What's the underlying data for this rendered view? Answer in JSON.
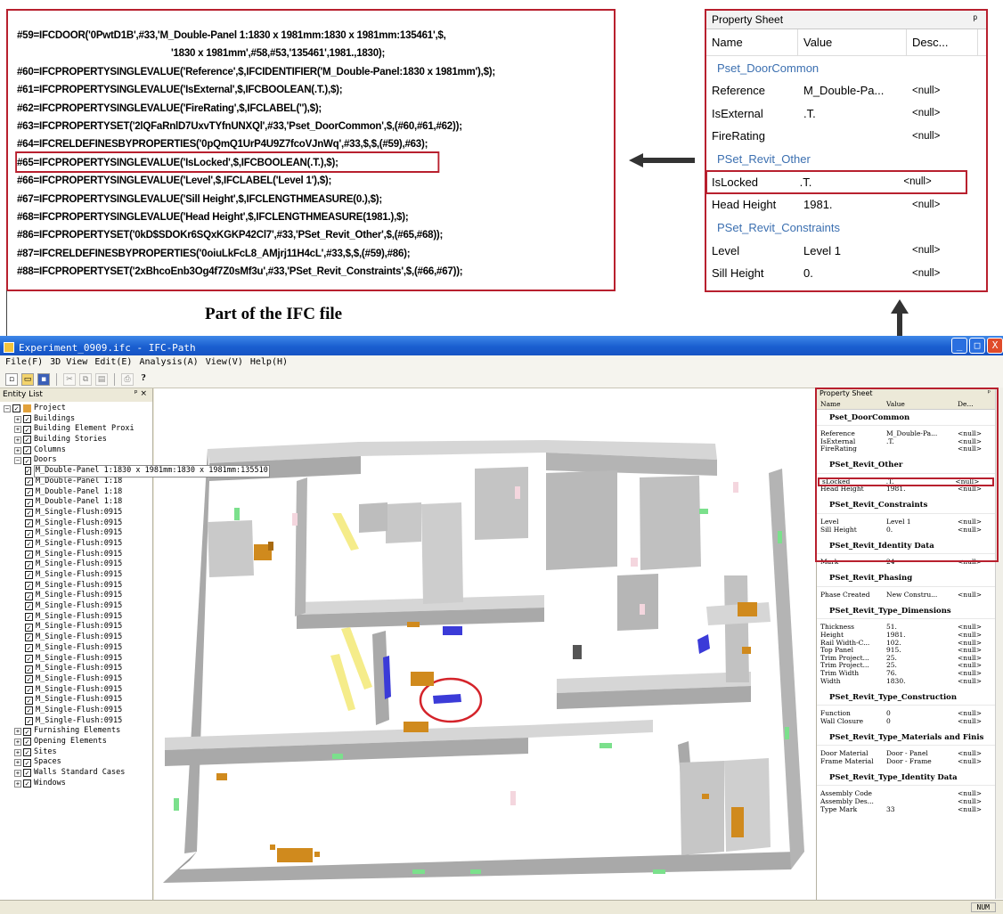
{
  "ifc_excerpt": {
    "lines": [
      "#59=IFCDOOR('0PwtD1B',#33,'M_Double-Panel 1:1830 x 1981mm:1830 x 1981mm:135461',$,",
      "'1830 x 1981mm',#58,#53,'135461',1981.,1830);",
      "#60=IFCPROPERTYSINGLEVALUE('Reference',$,IFCIDENTIFIER('M_Double-Panel:1830 x 1981mm'),$);",
      "#61=IFCPROPERTYSINGLEVALUE('IsExternal',$,IFCBOOLEAN(.T.),$);",
      "#62=IFCPROPERTYSINGLEVALUE('FireRating',$,IFCLABEL(''),$);",
      "#63=IFCPROPERTYSET('2lQFaRnlD7UxvTYfnUNXQl',#33,'Pset_DoorCommon',$,(#60,#61,#62));",
      "#64=IFCRELDEFINESBYPROPERTIES('0pQmQ1UrP4U9Z7fcoVJnWq',#33,$,$,(#59),#63);",
      "#65=IFCPROPERTYSINGLEVALUE('IsLocked',$,IFCBOOLEAN(.T.),$);",
      "#66=IFCPROPERTYSINGLEVALUE('Level',$,IFCLABEL('Level 1'),$);",
      "#67=IFCPROPERTYSINGLEVALUE('Sill Height',$,IFCLENGTHMEASURE(0.),$);",
      "#68=IFCPROPERTYSINGLEVALUE('Head Height',$,IFCLENGTHMEASURE(1981.),$);",
      "#86=IFCPROPERTYSET('0kD$SDOKr6SQxKGKP42Cl7',#33,'PSet_Revit_Other',$,(#65,#68));",
      "#87=IFCRELDEFINESBYPROPERTIES('0oiuLkFcL8_AMjrj11H4cL',#33,$,$,(#59),#86);",
      "#88=IFCPROPERTYSET('2xBhcoEnb3Og4f7Z0sMf3u',#33,'PSet_Revit_Constraints',$,(#66,#67));"
    ],
    "caption": "Part of the IFC file"
  },
  "zoom_sheet": {
    "title": "Property Sheet",
    "pin": "ᵖ",
    "columns": [
      "Name",
      "Value",
      "Desc..."
    ],
    "sections": [
      {
        "name": "Pset_DoorCommon",
        "rows": [
          {
            "name": "Reference",
            "value": "M_Double-Pa...",
            "desc": "<null>"
          },
          {
            "name": "IsExternal",
            "value": ".T.",
            "desc": "<null>"
          },
          {
            "name": "FireRating",
            "value": "",
            "desc": "<null>"
          }
        ]
      },
      {
        "name": "PSet_Revit_Other",
        "rows": [
          {
            "name": "IsLocked",
            "value": ".T.",
            "desc": "<null>"
          },
          {
            "name": "Head Height",
            "value": "1981.",
            "desc": "<null>"
          }
        ]
      },
      {
        "name": "PSet_Revit_Constraints",
        "rows": [
          {
            "name": "Level",
            "value": "Level 1",
            "desc": "<null>"
          },
          {
            "name": "Sill Height",
            "value": "0.",
            "desc": "<null>"
          }
        ]
      }
    ]
  },
  "app": {
    "title": "Experiment_0909.ifc - IFC-Path",
    "window_buttons": [
      "_",
      "□",
      "X"
    ],
    "menu": [
      "File(F)",
      "3D View",
      "Edit(E)",
      "Analysis(A)",
      "View(V)",
      "Help(H)"
    ],
    "entity_panel": {
      "title": "Entity List",
      "pin": "ᵖ ×",
      "tree": [
        {
          "label": "Project",
          "level": 0,
          "exp": "⊟"
        },
        {
          "label": "Buildings",
          "level": 1,
          "exp": "⊞"
        },
        {
          "label": "Building Element Proxi",
          "level": 1,
          "exp": "⊞"
        },
        {
          "label": "Building Stories",
          "level": 1,
          "exp": "⊞"
        },
        {
          "label": "Columns",
          "level": 1,
          "exp": "⊞"
        },
        {
          "label": "Doors",
          "level": 1,
          "exp": "⊟"
        },
        {
          "label": "M_Double-Panel 1:1830 x 1981mm:1830 x 1981mm:135510",
          "level": 2,
          "selected": true
        },
        {
          "label": "M_Double-Panel 1:18",
          "level": 2
        },
        {
          "label": "M_Double-Panel 1:18",
          "level": 2
        },
        {
          "label": "M_Double-Panel 1:18",
          "level": 2
        },
        {
          "label": "M_Single-Flush:0915",
          "level": 2
        },
        {
          "label": "M_Single-Flush:0915",
          "level": 2
        },
        {
          "label": "M_Single-Flush:0915",
          "level": 2
        },
        {
          "label": "M_Single-Flush:0915",
          "level": 2
        },
        {
          "label": "M_Single-Flush:0915",
          "level": 2
        },
        {
          "label": "M_Single-Flush:0915",
          "level": 2
        },
        {
          "label": "M_Single-Flush:0915",
          "level": 2
        },
        {
          "label": "M_Single-Flush:0915",
          "level": 2
        },
        {
          "label": "M_Single-Flush:0915",
          "level": 2
        },
        {
          "label": "M_Single-Flush:0915",
          "level": 2
        },
        {
          "label": "M_Single-Flush:0915",
          "level": 2
        },
        {
          "label": "M_Single-Flush:0915",
          "level": 2
        },
        {
          "label": "M_Single-Flush:0915",
          "level": 2
        },
        {
          "label": "M_Single-Flush:0915",
          "level": 2
        },
        {
          "label": "M_Single-Flush:0915",
          "level": 2
        },
        {
          "label": "M_Single-Flush:0915",
          "level": 2
        },
        {
          "label": "M_Single-Flush:0915",
          "level": 2
        },
        {
          "label": "M_Single-Flush:0915",
          "level": 2
        },
        {
          "label": "M_Single-Flush:0915",
          "level": 2
        },
        {
          "label": "M_Single-Flush:0915",
          "level": 2
        },
        {
          "label": "M_Single-Flush:0915",
          "level": 2
        },
        {
          "label": "Furnishing Elements",
          "level": 1,
          "exp": "⊞"
        },
        {
          "label": "Opening Elements",
          "level": 1,
          "exp": "⊞"
        },
        {
          "label": "Sites",
          "level": 1,
          "exp": "⊞"
        },
        {
          "label": "Spaces",
          "level": 1,
          "exp": "⊞"
        },
        {
          "label": "Walls Standard Cases",
          "level": 1,
          "exp": "⊞"
        },
        {
          "label": "Windows",
          "level": 1,
          "exp": "⊞"
        }
      ]
    },
    "small_sheet": {
      "title": "Property Sheet",
      "pin": "ᵖ",
      "columns": [
        "Name",
        "Value",
        "De..."
      ],
      "sections": [
        {
          "name": "Pset_DoorCommon",
          "rows": [
            {
              "name": "Reference",
              "value": "M_Double-Pa...",
              "desc": "<null>"
            },
            {
              "name": "IsExternal",
              "value": ".T.",
              "desc": "<null>"
            },
            {
              "name": "FireRating",
              "value": "",
              "desc": "<null>"
            }
          ]
        },
        {
          "name": "PSet_Revit_Other",
          "rows": [
            {
              "name": "sLocked",
              "value": ".T.",
              "desc": "<null>",
              "hl": true
            },
            {
              "name": "Head Height",
              "value": "1981.",
              "desc": "<null>"
            }
          ]
        },
        {
          "name": "PSet_Revit_Constraints",
          "rows": [
            {
              "name": "Level",
              "value": "Level 1",
              "desc": "<null>"
            },
            {
              "name": "Sill Height",
              "value": "0.",
              "desc": "<null>"
            }
          ]
        },
        {
          "name": "PSet_Revit_Identity Data",
          "rows": [
            {
              "name": "Mark",
              "value": "24",
              "desc": "<null>"
            }
          ]
        },
        {
          "name": "PSet_Revit_Phasing",
          "rows": [
            {
              "name": "Phase Created",
              "value": "New Constru...",
              "desc": "<null>"
            }
          ]
        },
        {
          "name": "PSet_Revit_Type_Dimensions",
          "rows": [
            {
              "name": "Thickness",
              "value": "51.",
              "desc": "<null>"
            },
            {
              "name": "Height",
              "value": "1981.",
              "desc": "<null>"
            },
            {
              "name": "Rail Width-C...",
              "value": "102.",
              "desc": "<null>"
            },
            {
              "name": "Top Panel",
              "value": "915.",
              "desc": "<null>"
            },
            {
              "name": "Trim Project...",
              "value": "25.",
              "desc": "<null>"
            },
            {
              "name": "Trim Project...",
              "value": "25.",
              "desc": "<null>"
            },
            {
              "name": "Trim Width",
              "value": "76.",
              "desc": "<null>"
            },
            {
              "name": "Width",
              "value": "1830.",
              "desc": "<null>"
            }
          ]
        },
        {
          "name": "PSet_Revit_Type_Construction",
          "rows": [
            {
              "name": "Function",
              "value": "0",
              "desc": "<null>"
            },
            {
              "name": "Wall Closure",
              "value": "0",
              "desc": "<null>"
            }
          ]
        },
        {
          "name": "PSet_Revit_Type_Materials and Finis",
          "rows": [
            {
              "name": "Door Material",
              "value": "Door - Panel",
              "desc": "<null>"
            },
            {
              "name": "Frame Material",
              "value": "Door - Frame",
              "desc": "<null>"
            }
          ]
        },
        {
          "name": "PSet_Revit_Type_Identity Data",
          "rows": [
            {
              "name": "Assembly Code",
              "value": "",
              "desc": "<null>"
            },
            {
              "name": "Assembly Des...",
              "value": "",
              "desc": "<null>"
            },
            {
              "name": "Type Mark",
              "value": "33",
              "desc": "<null>"
            }
          ]
        }
      ]
    },
    "status": {
      "num": "NUM"
    }
  },
  "colors": {
    "highlight_red": "#b8202e",
    "furniture": "#d08a1d",
    "window_green": "#7be08c",
    "door_blue": "#3b3bd8",
    "beam_yellow": "#f5ec8a",
    "wall_top": "#d6d6d6",
    "wall_side": "#a9a9a9"
  },
  "icons": [
    "new-file-icon",
    "open-folder-icon",
    "save-icon",
    "cut-icon",
    "copy-icon",
    "paste-icon",
    "print-icon",
    "help-icon",
    "checkbox-checked-icon",
    "project-icon",
    "pin-icon",
    "arrow-left-icon",
    "arrow-up-icon"
  ]
}
